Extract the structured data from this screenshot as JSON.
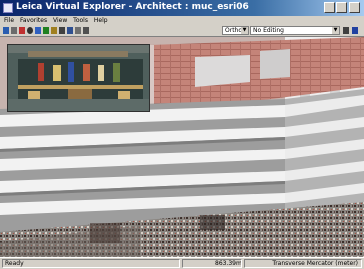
{
  "window": {
    "title": "Leica Virtual Explorer - Architect : muc_esri06"
  },
  "menu": [
    "File",
    "Favorites",
    "View",
    "Tools",
    "Help"
  ],
  "toolbar": {
    "projection_value": "Ortho",
    "editing_value": "No Editing"
  },
  "status": {
    "left": "Ready",
    "coordinate": "863.39m",
    "projection": "Transverse Mercator (meter)"
  },
  "icons": [
    "app-icon",
    "new-icon",
    "save-icon",
    "print-icon",
    "nav-icon",
    "zoom-icon",
    "layer-icon",
    "measure-icon",
    "grid-icon",
    "settings-icon",
    "pointer-icon",
    "help-icon",
    "minimize-icon",
    "maximize-icon",
    "close-icon"
  ]
}
